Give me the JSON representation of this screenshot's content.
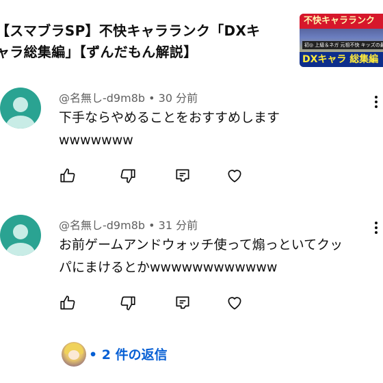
{
  "video": {
    "title": "【スマブラSP】不快キャラランク「DXキ\nャラ総集編」【ずんだもん解説】",
    "thumbnail": {
      "top_text": "不快キャラランク",
      "mid_text": "初◎ 上級＆ネガ  元祖不快  キッズの最",
      "bottom_text": "DXキャラ 総集編"
    }
  },
  "comments": [
    {
      "author": "@名無し-d9m8b",
      "time": "30 分前",
      "text": "下手ならやめることをおすすめします\nwwwwwww"
    },
    {
      "author": "@名無し-d9m8b",
      "time": "31 分前",
      "text": "お前ゲームアンドウォッチ使って煽っといてクッ\nパにまけるとかwwwwwwwwwwww"
    }
  ],
  "replies": {
    "label": "2 件の返信"
  },
  "colors": {
    "avatar": "#2aa392",
    "link": "#065fd4",
    "meta": "#606060"
  },
  "icons": [
    "thumbs-up-icon",
    "thumbs-down-icon",
    "reply-icon",
    "heart-icon",
    "more-vert-icon"
  ]
}
